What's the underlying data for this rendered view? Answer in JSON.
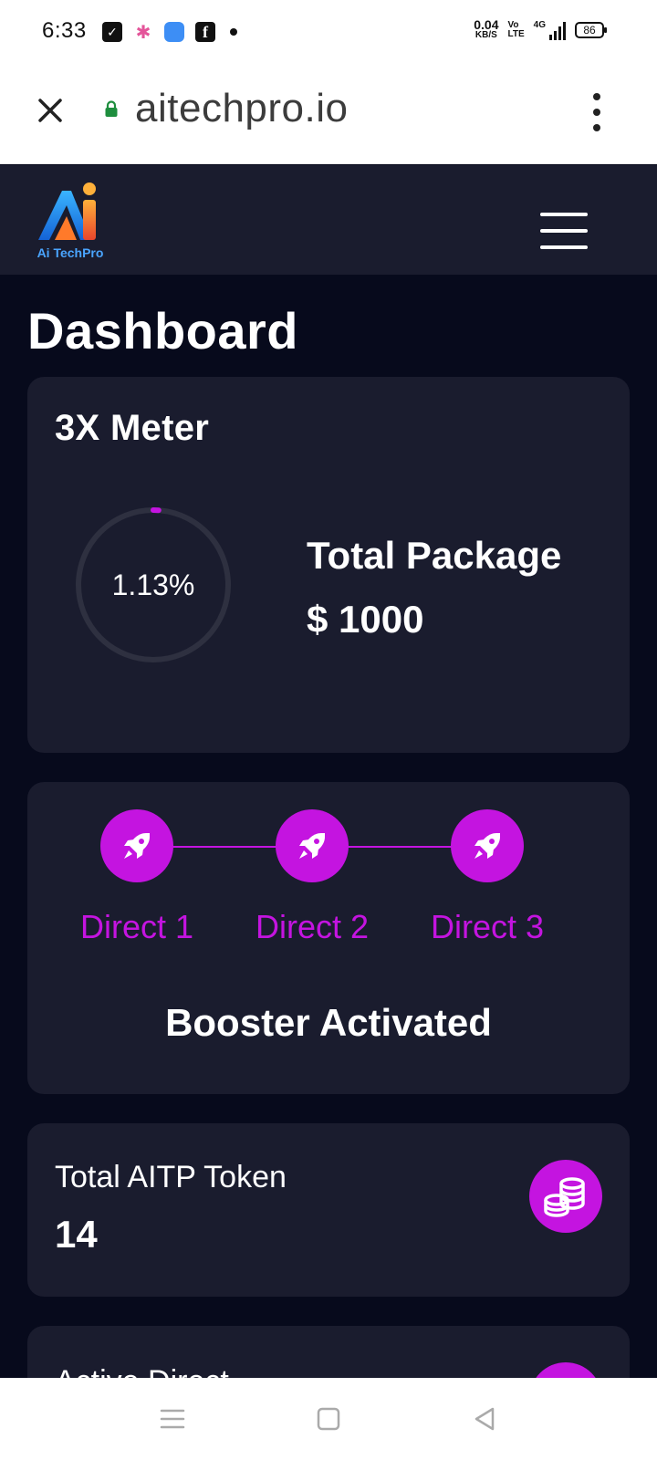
{
  "status_bar": {
    "time": "6:33",
    "net_speed_value": "0.04",
    "net_speed_unit": "KB/S",
    "volte_top": "Vo",
    "volte_bottom": "LTE",
    "network": "4G",
    "battery": "86"
  },
  "browser": {
    "url": "aitechpro.io"
  },
  "header": {
    "logo_text": "Ai TechPro"
  },
  "page": {
    "title": "Dashboard"
  },
  "meter_card": {
    "title": "3X Meter",
    "percent_text": "1.13%",
    "progress_fraction": 0.0113,
    "package_label": "Total Package",
    "package_value": "$ 1000"
  },
  "booster_card": {
    "directs": [
      "Direct 1",
      "Direct 2",
      "Direct 3"
    ],
    "status": "Booster Activated"
  },
  "token_card": {
    "label": "Total AITP Token",
    "value": "14"
  },
  "direct_card": {
    "label": "Active Direct"
  },
  "colors": {
    "accent": "#c414e0",
    "card_bg": "#1a1c2e",
    "page_bg": "#070a1c"
  }
}
